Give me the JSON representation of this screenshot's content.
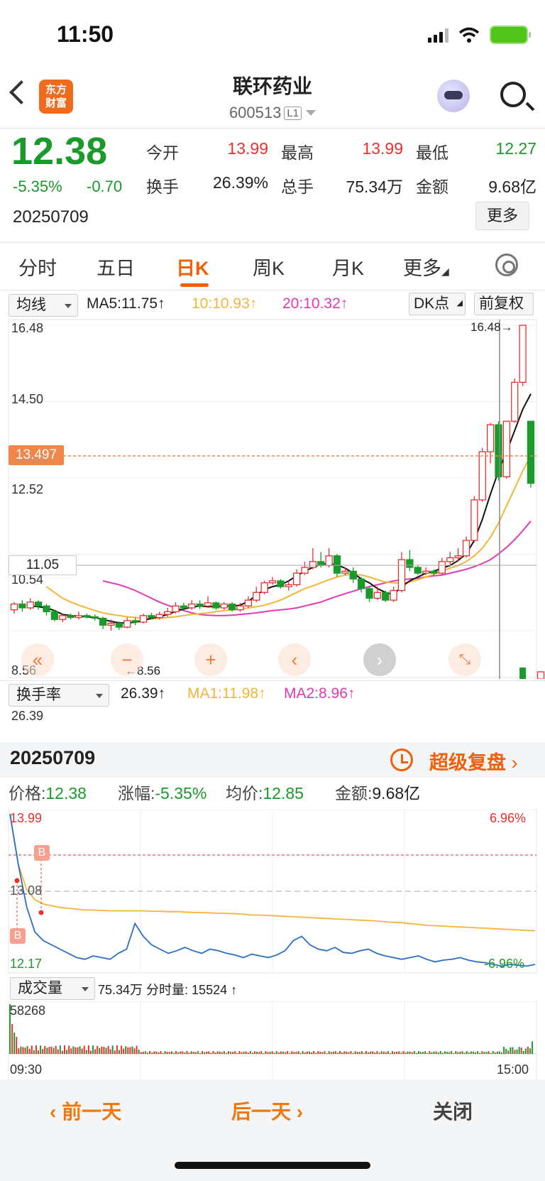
{
  "status": {
    "time": "11:50"
  },
  "header": {
    "app_logo_line1": "东方",
    "app_logo_line2": "财富",
    "stock_name": "联环药业",
    "stock_code": "600513",
    "level_badge": "L1"
  },
  "quote": {
    "price": "12.38",
    "change_pct": "-5.35%",
    "change": "-0.70",
    "date": "20250709",
    "open_label": "今开",
    "open_value": "13.99",
    "high_label": "最高",
    "high_value": "13.99",
    "low_label": "最低",
    "low_value": "12.27",
    "turnover_label": "换手",
    "turnover_value": "26.39%",
    "volume_label": "总手",
    "volume_value": "75.34万",
    "amount_label": "金额",
    "amount_value": "9.68亿",
    "more_button": "更多"
  },
  "tabs": [
    "分时",
    "五日",
    "日K",
    "周K",
    "月K",
    "更多"
  ],
  "active_tab": "日K",
  "kline": {
    "indicator_select": "均线",
    "ma5_text": "MA5:11.75↑",
    "ma10_text": "10:10.93↑",
    "ma20_text": "20:10.32↑",
    "dk_button": "DK点",
    "adjust_button": "前复权",
    "price_labels": [
      "16.48",
      "14.50",
      "12.52",
      "10.54",
      "8.56"
    ],
    "current_price_tag": "13.497",
    "ref_price_tag": "11.05",
    "high_marker": "16.48→",
    "low_marker": "←8.56",
    "colors": {
      "up": "#e5312f",
      "down": "#1a9a2a",
      "ma5": "#111111",
      "ma10": "#f5b53a",
      "ma20": "#e23ab4"
    }
  },
  "chart_data": [
    {
      "type": "candlestick",
      "title": "",
      "ylim": [
        8.56,
        16.48
      ],
      "yticks": [
        16.48,
        14.5,
        12.52,
        10.54,
        8.56
      ],
      "candles": [
        [
          9.1,
          9.25,
          9.3,
          9.0
        ],
        [
          9.25,
          9.15,
          9.35,
          9.05
        ],
        [
          9.15,
          9.3,
          9.4,
          9.1
        ],
        [
          9.3,
          9.2,
          9.35,
          9.1
        ],
        [
          9.2,
          9.05,
          9.25,
          8.95
        ],
        [
          9.05,
          8.85,
          9.1,
          8.8
        ],
        [
          8.85,
          8.95,
          9.0,
          8.78
        ],
        [
          8.95,
          8.9,
          9.0,
          8.85
        ],
        [
          8.9,
          8.95,
          9.05,
          8.85
        ],
        [
          8.95,
          8.92,
          9.0,
          8.88
        ],
        [
          8.92,
          8.88,
          8.98,
          8.82
        ],
        [
          8.88,
          8.7,
          8.92,
          8.6
        ],
        [
          8.7,
          8.75,
          8.85,
          8.56
        ],
        [
          8.75,
          8.65,
          8.8,
          8.58
        ],
        [
          8.65,
          8.82,
          8.9,
          8.62
        ],
        [
          8.82,
          8.78,
          8.9,
          8.7
        ],
        [
          8.78,
          8.95,
          9.0,
          8.75
        ],
        [
          8.95,
          8.9,
          9.02,
          8.85
        ],
        [
          8.9,
          8.98,
          9.05,
          8.85
        ],
        [
          8.98,
          9.05,
          9.15,
          8.92
        ],
        [
          9.05,
          9.2,
          9.3,
          9.0
        ],
        [
          9.2,
          9.15,
          9.28,
          9.08
        ],
        [
          9.15,
          9.25,
          9.35,
          9.1
        ],
        [
          9.25,
          9.2,
          9.35,
          9.12
        ],
        [
          9.2,
          9.28,
          9.45,
          9.15
        ],
        [
          9.28,
          9.15,
          9.32,
          9.1
        ],
        [
          9.15,
          9.25,
          9.3,
          9.1
        ],
        [
          9.25,
          9.1,
          9.3,
          9.05
        ],
        [
          9.1,
          9.2,
          9.28,
          9.05
        ],
        [
          9.2,
          9.35,
          9.45,
          9.15
        ],
        [
          9.35,
          9.55,
          9.7,
          9.3
        ],
        [
          9.55,
          9.8,
          9.85,
          9.5
        ],
        [
          9.8,
          9.85,
          9.95,
          9.75
        ],
        [
          9.85,
          9.7,
          9.9,
          9.65
        ],
        [
          9.7,
          9.75,
          9.85,
          9.6
        ],
        [
          9.75,
          10.05,
          10.15,
          9.7
        ],
        [
          10.05,
          10.2,
          10.35,
          10.0
        ],
        [
          10.2,
          10.35,
          10.7,
          10.15
        ],
        [
          10.35,
          10.25,
          10.6,
          10.2
        ],
        [
          10.25,
          10.5,
          10.7,
          10.2
        ],
        [
          10.5,
          10.05,
          10.55,
          9.95
        ],
        [
          10.05,
          10.1,
          10.2,
          10.0
        ],
        [
          10.1,
          9.9,
          10.2,
          9.8
        ],
        [
          9.9,
          9.65,
          9.95,
          9.55
        ],
        [
          9.65,
          9.4,
          9.7,
          9.3
        ],
        [
          9.4,
          9.55,
          9.7,
          9.35
        ],
        [
          9.55,
          9.35,
          9.6,
          9.3
        ],
        [
          9.35,
          9.6,
          9.7,
          9.3
        ],
        [
          9.6,
          10.4,
          10.6,
          9.55
        ],
        [
          10.4,
          10.2,
          10.65,
          10.1
        ],
        [
          10.2,
          10.05,
          10.25,
          10.0
        ],
        [
          10.05,
          10.1,
          10.2,
          10.0
        ],
        [
          10.1,
          10.05,
          10.15,
          10.0
        ],
        [
          10.05,
          10.35,
          10.45,
          10.0
        ],
        [
          10.35,
          10.45,
          10.6,
          10.25
        ],
        [
          10.45,
          10.5,
          10.7,
          10.35
        ],
        [
          10.5,
          10.9,
          11.0,
          10.45
        ],
        [
          10.9,
          11.95,
          12.05,
          10.85
        ],
        [
          11.95,
          13.2,
          13.3,
          11.9
        ],
        [
          13.2,
          13.9,
          13.95,
          12.9
        ],
        [
          13.9,
          12.55,
          13.99,
          12.45
        ],
        [
          12.55,
          13.99,
          14.0,
          12.5
        ],
        [
          13.99,
          15.0,
          15.1,
          13.95
        ],
        [
          15.0,
          16.48,
          16.48,
          14.9
        ],
        [
          13.99,
          12.38,
          13.99,
          12.27
        ]
      ],
      "ma5": [
        9.2,
        9.18,
        9.15,
        9.08,
        8.98,
        8.95,
        8.93,
        8.92,
        8.9,
        8.85,
        8.8,
        8.76,
        8.76,
        8.78,
        8.82,
        8.88,
        8.92,
        8.98,
        9.06,
        9.12,
        9.17,
        9.2,
        9.18,
        9.18,
        9.2,
        9.2,
        9.22,
        9.32,
        9.48,
        9.62,
        9.7,
        9.75,
        9.85,
        9.98,
        10.1,
        10.2,
        10.28,
        10.3,
        10.26,
        10.18,
        10.05,
        9.9,
        9.8,
        9.65,
        9.55,
        9.5,
        9.7,
        9.85,
        9.95,
        10.05,
        10.1,
        10.18,
        10.25,
        10.38,
        10.55,
        10.9,
        11.45,
        12.1,
        12.7,
        13.2,
        13.75,
        14.3,
        14.7
      ],
      "ma10": [
        9.7,
        9.55,
        9.4,
        9.3,
        9.22,
        9.15,
        9.08,
        9.02,
        8.98,
        8.95,
        8.92,
        8.9,
        8.88,
        8.86,
        8.88,
        8.9,
        8.92,
        8.95,
        8.98,
        9.0,
        9.02,
        9.05,
        9.08,
        9.1,
        9.12,
        9.15,
        9.18,
        9.22,
        9.28,
        9.35,
        9.45,
        9.55,
        9.65,
        9.72,
        9.8,
        9.88,
        9.95,
        10.0,
        10.02,
        10.0,
        9.95,
        9.88,
        9.82,
        9.8,
        9.8,
        9.82,
        9.88,
        9.95,
        10.02,
        10.1,
        10.18,
        10.25,
        10.35,
        10.5,
        10.7,
        10.98,
        11.35,
        11.8,
        12.25,
        12.7,
        13.1
      ],
      "ma20": [
        9.85,
        9.8,
        9.75,
        9.68,
        9.6,
        9.5,
        9.4,
        9.3,
        9.22,
        9.15,
        9.08,
        9.02,
        8.98,
        8.96,
        8.95,
        8.95,
        8.96,
        8.98,
        9.0,
        9.02,
        9.05,
        9.08,
        9.1,
        9.12,
        9.15,
        9.2,
        9.25,
        9.3,
        9.38,
        9.45,
        9.52,
        9.58,
        9.65,
        9.7,
        9.75,
        9.8,
        9.85,
        9.88,
        9.9,
        9.92,
        9.95,
        9.98,
        10.0,
        10.05,
        10.1,
        10.15,
        10.22,
        10.3,
        10.4,
        10.55,
        10.72,
        10.92,
        11.15,
        11.4
      ]
    },
    {
      "type": "line",
      "title": "",
      "ylim": [
        12.17,
        13.99
      ],
      "series": [
        {
          "name": "价格",
          "values": [
            13.99,
            13.4,
            12.9,
            12.6,
            12.5,
            12.45,
            12.4,
            12.35,
            12.3,
            12.28,
            12.32,
            12.3,
            12.28,
            12.35,
            12.4,
            12.7,
            12.55,
            12.45,
            12.4,
            12.35,
            12.38,
            12.42,
            12.38,
            12.35,
            12.4,
            12.38,
            12.35,
            12.33,
            12.3,
            12.34,
            12.32,
            12.3,
            12.33,
            12.38,
            12.5,
            12.55,
            12.45,
            12.4,
            12.38,
            12.42,
            12.36,
            12.35,
            12.38,
            12.4,
            12.35,
            12.32,
            12.3,
            12.28,
            12.3,
            12.32,
            12.28,
            12.25,
            12.27,
            12.28,
            12.3,
            12.27,
            12.25,
            12.24,
            12.22,
            12.2,
            12.22,
            12.21,
            12.2,
            12.22
          ]
        },
        {
          "name": "均价",
          "values": [
            13.99,
            13.4,
            13.1,
            12.98,
            12.93,
            12.91,
            12.89,
            12.88,
            12.87,
            12.86,
            12.86,
            12.855,
            12.85,
            12.85,
            12.85,
            12.85,
            12.85,
            12.845,
            12.845,
            12.84,
            12.84,
            12.835,
            12.83,
            12.83,
            12.825,
            12.82,
            12.82,
            12.815,
            12.81,
            12.8,
            12.8,
            12.795,
            12.79,
            12.785,
            12.78,
            12.775,
            12.77,
            12.765,
            12.76,
            12.755,
            12.75,
            12.745,
            12.74,
            12.735,
            12.73,
            12.72,
            12.715,
            12.71,
            12.7,
            12.69,
            12.68,
            12.675,
            12.67,
            12.665,
            12.66,
            12.655,
            12.65,
            12.645,
            12.64,
            12.635,
            12.63,
            12.625,
            12.62,
            12.615
          ]
        }
      ]
    }
  ],
  "turnover": {
    "select": "换手率",
    "value_text": "26.39↑",
    "ma1_text": "MA1:11.98↑",
    "ma2_text": "MA2:8.96↑",
    "axis_top": "26.39"
  },
  "replay": {
    "date": "20250709",
    "link_text": "超级复盘",
    "price_label": "价格:",
    "price_value": "12.38",
    "change_label": "涨幅:",
    "change_value": "-5.35%",
    "avg_label": "均价:",
    "avg_value": "12.85",
    "amount_label": "金额:",
    "amount_value": "9.68亿",
    "intraday_high": "13.99",
    "intraday_mid": "13.08",
    "intraday_low": "12.17",
    "pct_high": "6.96%",
    "pct_low": "-6.96%",
    "buy_marker": "B",
    "volume_select": "成交量",
    "volume_text": "75.34万 分时量: 15524 ↑",
    "volume_axis_top": "58268",
    "time_start": "09:30",
    "time_end": "15:00"
  },
  "bottom": {
    "prev_day": "前一天",
    "next_day": "后一天",
    "close": "关闭"
  }
}
